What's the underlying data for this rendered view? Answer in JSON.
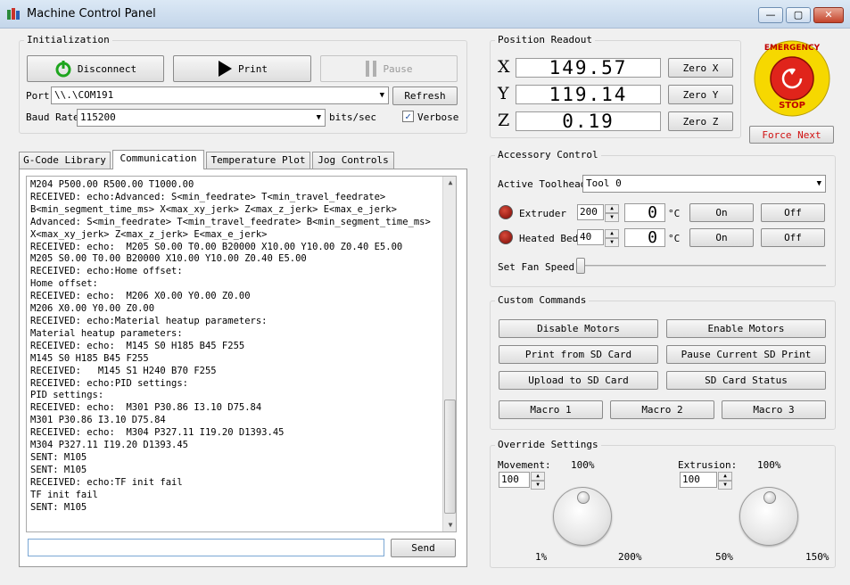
{
  "window": {
    "title": "Machine Control Panel",
    "min": "—",
    "max": "▢",
    "close": "✕"
  },
  "init": {
    "label": "Initialization",
    "disconnect": "Disconnect",
    "print": "Print",
    "pause": "Pause",
    "port_label": "Port",
    "port_value": "\\\\.\\COM191",
    "refresh": "Refresh",
    "baud_label": "Baud Rate",
    "baud_value": "115200",
    "baud_unit": "bits/sec",
    "verbose": "Verbose",
    "verbose_checked": true
  },
  "position": {
    "label": "Position Readout",
    "x_axis": "X",
    "x_value": "149.57",
    "zero_x": "Zero X",
    "y_axis": "Y",
    "y_value": "119.14",
    "zero_y": "Zero Y",
    "z_axis": "Z",
    "z_value": "0.19",
    "zero_z": "Zero Z"
  },
  "estop": {
    "top": "EMERGENCY",
    "bottom": "STOP",
    "force_next": "Force Next"
  },
  "tabs": [
    "G-Code Library",
    "Communication",
    "Temperature Plot",
    "Jog Controls"
  ],
  "log": [
    "M204 P500.00 R500.00 T1000.00",
    "RECEIVED: echo:Advanced: S<min_feedrate> T<min_travel_feedrate>",
    "B<min_segment_time_ms> X<max_xy_jerk> Z<max_z_jerk> E<max_e_jerk>",
    "Advanced: S<min_feedrate> T<min_travel_feedrate> B<min_segment_time_ms>",
    "X<max_xy_jerk> Z<max_z_jerk> E<max_e_jerk>",
    "RECEIVED: echo:  M205 S0.00 T0.00 B20000 X10.00 Y10.00 Z0.40 E5.00",
    "M205 S0.00 T0.00 B20000 X10.00 Y10.00 Z0.40 E5.00",
    "RECEIVED: echo:Home offset:",
    "Home offset:",
    "RECEIVED: echo:  M206 X0.00 Y0.00 Z0.00",
    "M206 X0.00 Y0.00 Z0.00",
    "RECEIVED: echo:Material heatup parameters:",
    "Material heatup parameters:",
    "RECEIVED: echo:  M145 S0 H185 B45 F255",
    "M145 S0 H185 B45 F255",
    "RECEIVED:   M145 S1 H240 B70 F255",
    "RECEIVED: echo:PID settings:",
    "PID settings:",
    "RECEIVED: echo:  M301 P30.86 I3.10 D75.84",
    "M301 P30.86 I3.10 D75.84",
    "RECEIVED: echo:  M304 P327.11 I19.20 D1393.45",
    "M304 P327.11 I19.20 D1393.45",
    "SENT: M105",
    "SENT: M105",
    "RECEIVED: echo:TF init fail",
    "TF init fail",
    "SENT: M105"
  ],
  "command": {
    "value": "",
    "send": "Send"
  },
  "accessory": {
    "label": "Accessory Control",
    "toolhead_label": "Active Toolhead",
    "toolhead_value": "Tool 0",
    "extruder_label": "Extruder",
    "extruder_target": "200",
    "extruder_current": "0",
    "bed_label": "Heated Bed",
    "bed_target": "40",
    "bed_current": "0",
    "unit": "°C",
    "on": "On",
    "off": "Off",
    "fan_label": "Set Fan Speed"
  },
  "custom": {
    "label": "Custom Commands",
    "disable_motors": "Disable Motors",
    "enable_motors": "Enable Motors",
    "print_sd": "Print from SD Card",
    "pause_sd": "Pause Current SD Print",
    "upload_sd": "Upload to SD Card",
    "sd_status": "SD Card Status",
    "macro1": "Macro 1",
    "macro2": "Macro 2",
    "macro3": "Macro 3"
  },
  "override": {
    "label": "Override Settings",
    "movement_label": "Movement:",
    "movement_value": "100",
    "movement_center": "100%",
    "movement_min": "1%",
    "movement_max": "200%",
    "extrusion_label": "Extrusion:",
    "extrusion_value": "100",
    "extrusion_center": "100%",
    "extrusion_min": "50%",
    "extrusion_max": "150%"
  },
  "colors": {
    "estop_red": "#e0241b",
    "estop_yellow": "#f6d800",
    "force_next": "#d01010",
    "connect_green": "#1ea51e"
  }
}
